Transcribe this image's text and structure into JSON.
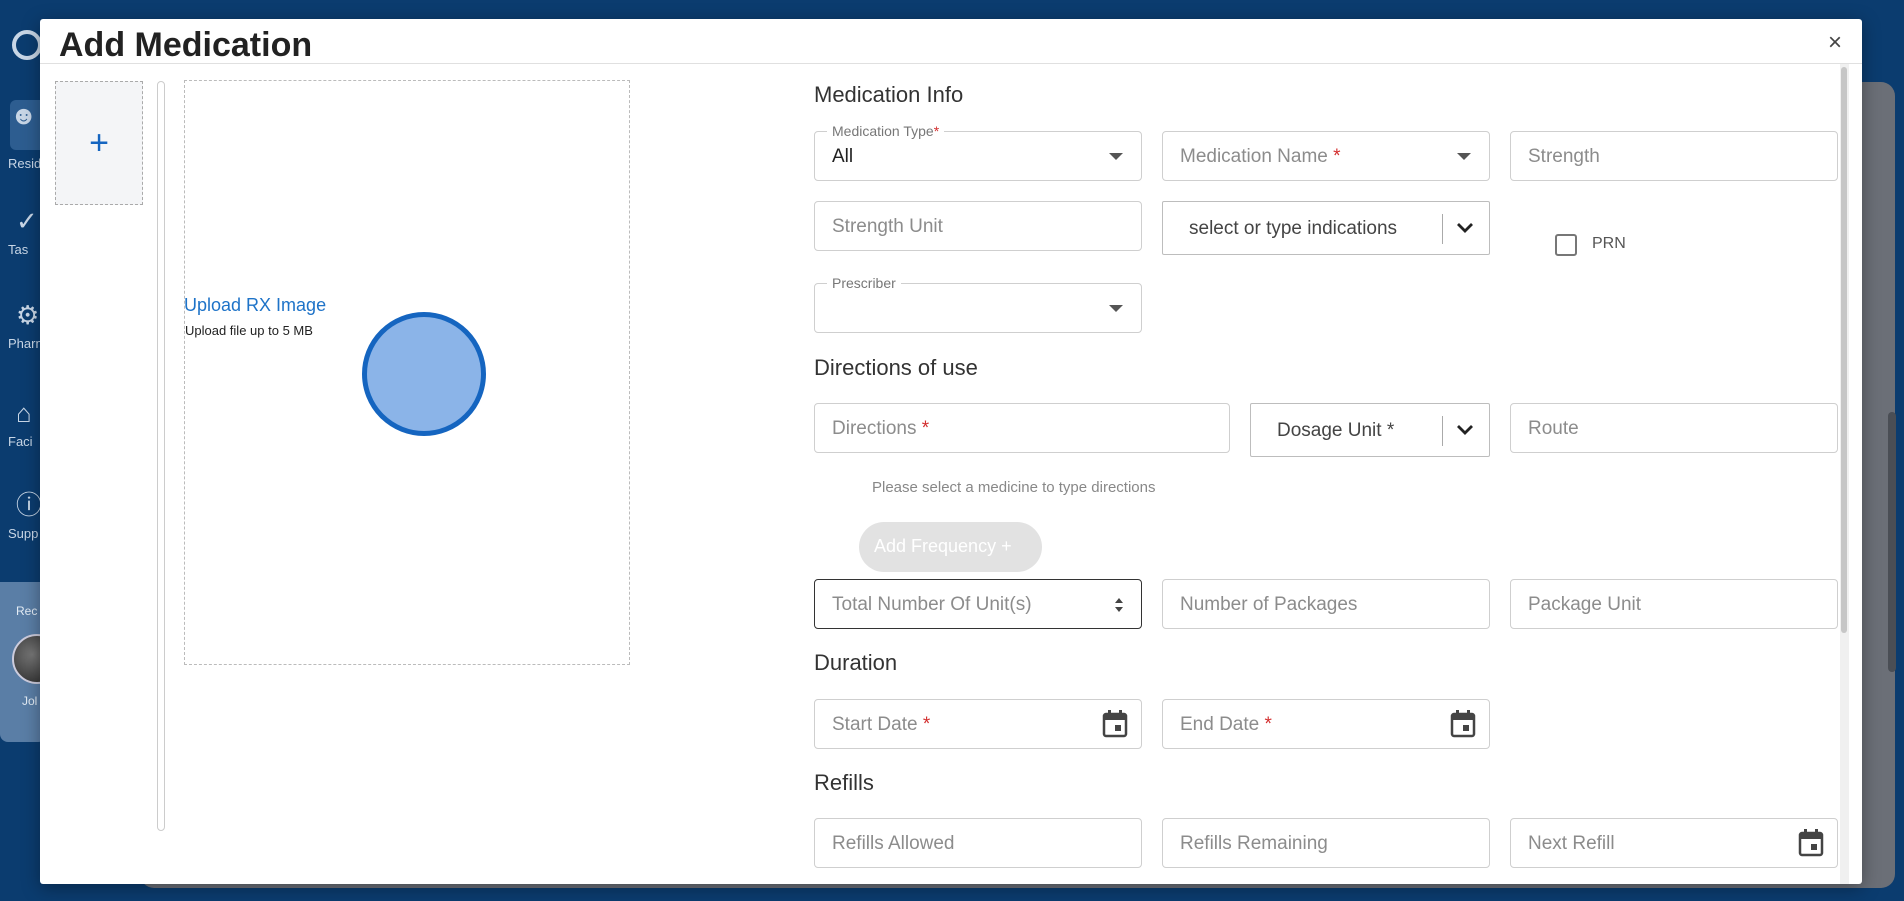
{
  "background": {
    "nav": [
      {
        "label": "Resid",
        "icon": "person-icon"
      },
      {
        "label": "Tas",
        "icon": "check-icon"
      },
      {
        "label": "Pharm",
        "icon": "gear-icon"
      },
      {
        "label": "Faci",
        "icon": "home-icon"
      },
      {
        "label": "Supp",
        "icon": "help-icon"
      }
    ],
    "recent_label": "Rec",
    "recent_name": "Jol"
  },
  "dialog": {
    "title": "Add Medication",
    "close": "×"
  },
  "upload": {
    "add_label": "+",
    "title": "Upload RX Image",
    "subtitle": "Upload file up to 5 MB"
  },
  "sections": {
    "medication_info": "Medication Info",
    "directions": "Directions of use",
    "duration": "Duration",
    "refills": "Refills"
  },
  "fields": {
    "medication_type_label": "Medication Type",
    "medication_type_value": "All",
    "medication_name": "Medication Name",
    "strength": "Strength",
    "strength_unit": "Strength Unit",
    "indications": "select or type indications",
    "prn": "PRN",
    "prescriber_label": "Prescriber",
    "directions": "Directions",
    "dosage_unit": "Dosage Unit *",
    "route": "Route",
    "directions_helper": "Please select a medicine to type directions",
    "add_frequency": "Add Frequency  +",
    "total_units": "Total Number Of Unit(s)",
    "num_packages": "Number of Packages",
    "package_unit": "Package Unit",
    "start_date": "Start Date",
    "end_date": "End Date",
    "refills_allowed": "Refills Allowed",
    "refills_remaining": "Refills Remaining",
    "next_refill": "Next Refill",
    "required_mark": "*"
  },
  "colors": {
    "brand": "#0b3c6f",
    "accent": "#1565c0",
    "required": "#d32f2f"
  }
}
